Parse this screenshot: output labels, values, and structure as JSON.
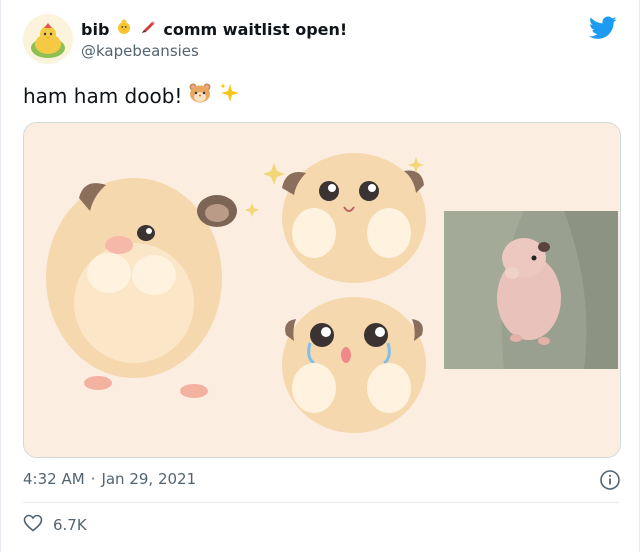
{
  "user": {
    "display_name": "bib",
    "name_suffix": "comm waitlist open!",
    "handle": "@kapebeansies"
  },
  "tweet": {
    "text": "ham ham doob!"
  },
  "meta": {
    "time": "4:32 AM",
    "separator": "·",
    "date": "Jan 29, 2021"
  },
  "actions": {
    "like_count": "6.7K"
  },
  "colors": {
    "twitter_blue": "#1d9bf0",
    "muted_text": "#536471",
    "media_background": "#fbeee0"
  },
  "icons": [
    "twitter-bird-icon",
    "info-icon",
    "heart-icon",
    "chick-emoji",
    "pencil-emoji",
    "hamster-emoji",
    "sparkles-emoji"
  ]
}
